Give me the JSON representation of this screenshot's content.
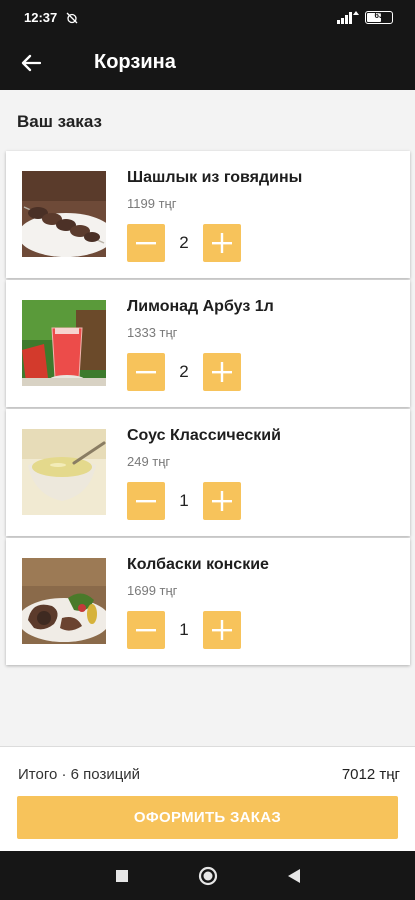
{
  "status_bar": {
    "time": "12:37",
    "battery": "63",
    "battery_level": 0.63
  },
  "app_bar": {
    "title": "Корзина"
  },
  "order": {
    "section_title": "Ваш заказ",
    "items": [
      {
        "name": "Шашлык из говядины",
        "price": "1199 тңг",
        "quantity": "2",
        "image": "beef-shashlik"
      },
      {
        "name": "Лимонад Арбуз 1л",
        "price": "1333 тңг",
        "quantity": "2",
        "image": "watermelon-lemonade"
      },
      {
        "name": "Соус Классический",
        "price": "249 тңг",
        "quantity": "1",
        "image": "classic-sauce"
      },
      {
        "name": "Колбаски конские",
        "price": "1699 тңг",
        "quantity": "1",
        "image": "horse-sausages"
      }
    ]
  },
  "footer": {
    "total_label": "Итого · 6 позиций",
    "total_sum": "7012 тңг",
    "checkout_label": "ОФОРМИТЬ ЗАКАЗ"
  },
  "colors": {
    "accent": "#f7c35b",
    "bar": "#161616",
    "background": "#f3f3f3"
  },
  "icons": [
    "back-arrow-icon",
    "minus-icon",
    "plus-icon",
    "nav-recents-icon",
    "nav-home-icon",
    "nav-back-icon"
  ]
}
